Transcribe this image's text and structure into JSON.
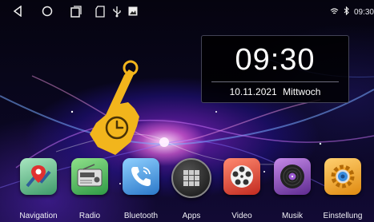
{
  "status_bar": {
    "nav_icons": [
      "back-icon",
      "home-icon",
      "recent-apps-icon",
      "sd-card-icon",
      "usb-icon",
      "image-icon"
    ],
    "right_icons": [
      "wifi-icon",
      "bluetooth-icon"
    ],
    "time": "09:30"
  },
  "clock_widget": {
    "time": "09:30",
    "date": "10.11.2021",
    "weekday": "Mittwoch"
  },
  "gesture_hint": {
    "icon": "tap-clock-hand-icon",
    "color": "#f2b51c"
  },
  "dock": {
    "apps": [
      {
        "label": "Navigation",
        "icon": "map-pin-icon",
        "color": "#7fd0a0"
      },
      {
        "label": "Radio",
        "icon": "radio-icon",
        "color": "#5fc46a"
      },
      {
        "label": "Bluetooth",
        "icon": "phone-icon",
        "color": "#4aa0e0"
      },
      {
        "label": "Apps",
        "icon": "apps-grid-icon",
        "color": "#2a2a2a"
      },
      {
        "label": "Video",
        "icon": "film-reel-icon",
        "color": "#e04a3a"
      },
      {
        "label": "Musik",
        "icon": "vinyl-record-icon",
        "color": "#8a4ab0"
      },
      {
        "label": "Einstellung",
        "icon": "gear-icon",
        "color": "#f0a020"
      }
    ]
  }
}
